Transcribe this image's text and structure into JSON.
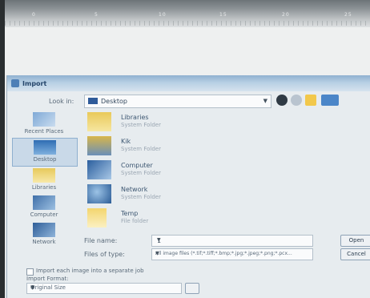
{
  "ruler": {
    "marks": [
      "0",
      "5",
      "10",
      "15",
      "20",
      "25"
    ]
  },
  "dialog": {
    "title": "Import",
    "look_in": {
      "label": "Look in:",
      "value": "Desktop"
    },
    "places": [
      {
        "label": "Recent Places",
        "icon": "recent-places-icon"
      },
      {
        "label": "Desktop",
        "icon": "desktop-icon",
        "selected": true
      },
      {
        "label": "Libraries",
        "icon": "libraries-icon"
      },
      {
        "label": "Computer",
        "icon": "computer-icon"
      },
      {
        "label": "Network",
        "icon": "network-icon"
      }
    ],
    "files": [
      {
        "name": "Libraries",
        "type": "System Folder",
        "icon": "libraries-folder-icon"
      },
      {
        "name": "Kik",
        "type": "System Folder",
        "icon": "user-folder-icon"
      },
      {
        "name": "Computer",
        "type": "System Folder",
        "icon": "computer-icon"
      },
      {
        "name": "Network",
        "type": "System Folder",
        "icon": "network-icon"
      },
      {
        "name": "Temp",
        "type": "File folder",
        "icon": "folder-icon"
      },
      {
        "name": "",
        "type": "",
        "icon": "folder-icon"
      }
    ],
    "file_name": {
      "label": "File name:",
      "value": "1"
    },
    "file_type": {
      "label": "Files of type:",
      "value": "All image files (*.tif;*.tiff;*.bmp;*.jpg;*.jpeg;*.png;*.pcx..."
    },
    "buttons": {
      "open": "Open",
      "cancel": "Cancel"
    },
    "separate_job": {
      "label": "Import each image into a separate job",
      "checked": false
    },
    "image_format": {
      "label": "Import Format:",
      "value": "Original Size"
    }
  }
}
